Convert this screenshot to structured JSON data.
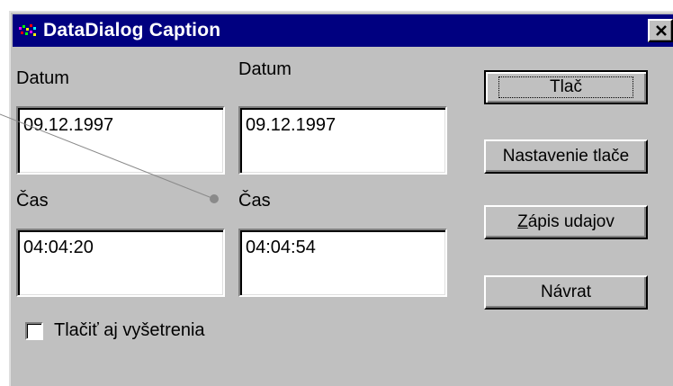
{
  "window": {
    "title": "DataDialog Caption",
    "icon": "app-multicolor-icon",
    "close_icon": "close-icon",
    "title_bar_color": "#000080"
  },
  "form": {
    "date_label_1": "Datum",
    "date_label_2": "Datum",
    "date_value_1": "09.12.1997",
    "date_value_2": "09.12.1997",
    "time_label_1": "Čas",
    "time_label_2": "Čas",
    "time_value_1": "04:04:20",
    "time_value_2": "04:04:54",
    "checkbox_label": "Tlačiť aj vyšetrenia",
    "checkbox_checked": false
  },
  "buttons": {
    "print": "Tlač",
    "print_settings": "Nastavenie tlače",
    "write_data_first": "Z",
    "write_data_rest": "ápis udajov",
    "return": "Návrat"
  }
}
